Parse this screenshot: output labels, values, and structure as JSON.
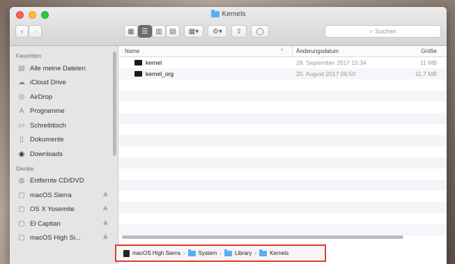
{
  "window": {
    "title": "Kernels",
    "accent": "#5aaef0"
  },
  "toolbar": {
    "back_label": "‹",
    "forward_label": "›",
    "search_placeholder": "Suchen"
  },
  "sidebar": {
    "favorites_header": "Favoriten",
    "favorites": [
      {
        "label": "Alle meine Dateien",
        "icon": "all-files-icon"
      },
      {
        "label": "iCloud Drive",
        "icon": "cloud-icon"
      },
      {
        "label": "AirDrop",
        "icon": "airdrop-icon"
      },
      {
        "label": "Programme",
        "icon": "applications-icon"
      },
      {
        "label": "Schreibtisch",
        "icon": "desktop-icon"
      },
      {
        "label": "Dokumente",
        "icon": "documents-icon"
      },
      {
        "label": "Downloads",
        "icon": "downloads-icon"
      }
    ],
    "devices_header": "Geräte",
    "devices": [
      {
        "label": "Entfernte CD/DVD",
        "icon": "remote-disc-icon"
      },
      {
        "label": "macOS Sierra",
        "icon": "disk-icon"
      },
      {
        "label": "OS X Yosemite",
        "icon": "disk-icon"
      },
      {
        "label": "El Capitan",
        "icon": "disk-icon"
      },
      {
        "label": "macOS High Si...",
        "icon": "disk-icon"
      }
    ],
    "eject_symbol": "≜"
  },
  "list": {
    "columns": {
      "name": "Name",
      "date": "Änderungsdatum",
      "size": "Größe",
      "sort_arrow": "^"
    },
    "rows": [
      {
        "name": "kernel",
        "date": "28. September 2017 15:34",
        "size": "11 MB"
      },
      {
        "name": "kernel_org",
        "date": "25. August 2017 06:50",
        "size": "11,7 MB"
      }
    ]
  },
  "pathbar": {
    "items": [
      "macOS High Sierra",
      "System",
      "Library",
      "Kernels"
    ],
    "separator": "›",
    "highlight_color": "#e03a2f"
  }
}
